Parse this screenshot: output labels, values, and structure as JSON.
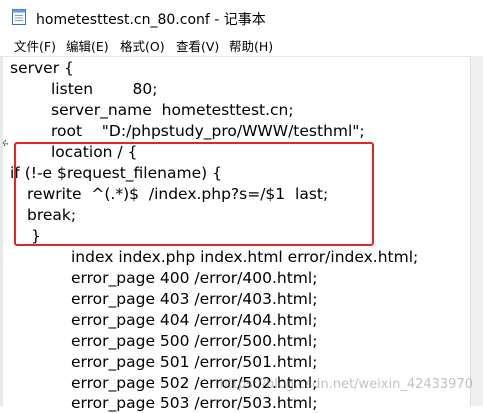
{
  "window": {
    "title": "hometesttest.cn_80.conf - 记事本",
    "icon": "notepad-icon"
  },
  "menu": {
    "file": "文件(F)",
    "edit": "编辑(E)",
    "format": "格式(O)",
    "view": "查看(V)",
    "help": "帮助(H)"
  },
  "editor": {
    "lines": [
      "server {",
      "listen        80;",
      "server_name  hometesttest.cn;",
      "root    \"D:/phpstudy_pro/WWW/testhml\";",
      "location / {",
      "if (!-e $request_filename) {",
      "rewrite  ^(.*)$  /index.php?s=/$1  last;",
      "break;",
      "}",
      "index index.php index.html error/index.html;",
      "error_page 400 /error/400.html;",
      "error_page 403 /error/403.html;",
      "error_page 404 /error/404.html;",
      "error_page 500 /error/500.html;",
      "error_page 501 /error/501.html;",
      "error_page 502 /error/502.html;",
      "error_page 503 /error/503.html;"
    ],
    "left_marker": "ሩ"
  },
  "annotation": {
    "highlight_color": "#e0262b"
  },
  "watermark": {
    "text": "https://blog.csdn.net/weixin_42433970"
  }
}
